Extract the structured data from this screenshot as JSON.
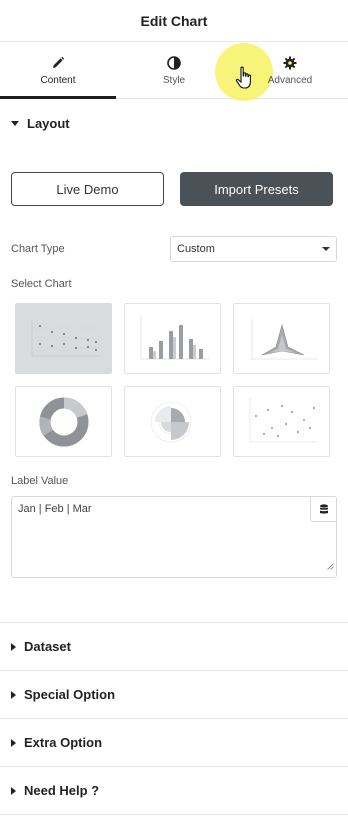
{
  "header": {
    "title": "Edit Chart"
  },
  "tabs": [
    {
      "label": "Content",
      "icon": "pencil-icon",
      "active": true
    },
    {
      "label": "Style",
      "icon": "contrast-icon",
      "active": false
    },
    {
      "label": "Advanced",
      "icon": "gear-icon",
      "active": false
    }
  ],
  "layout": {
    "title": "Layout",
    "live_demo_label": "Live Demo",
    "import_presets_label": "Import Presets",
    "chart_type_label": "Chart Type",
    "chart_type_value": "Custom",
    "select_chart_label": "Select Chart",
    "chart_options": [
      {
        "icon": "line-chart-icon",
        "selected": true
      },
      {
        "icon": "bar-chart-icon",
        "selected": false
      },
      {
        "icon": "radar-chart-icon",
        "selected": false
      },
      {
        "icon": "doughnut-chart-icon",
        "selected": false
      },
      {
        "icon": "polar-area-chart-icon",
        "selected": false
      },
      {
        "icon": "scatter-chart-icon",
        "selected": false
      }
    ],
    "label_value_label": "Label Value",
    "label_value_text": "Jan | Feb | Mar"
  },
  "sections": [
    {
      "title": "Dataset"
    },
    {
      "title": "Special Option"
    },
    {
      "title": "Extra Option"
    },
    {
      "title": "Need Help ?"
    }
  ],
  "colors": {
    "dark_button": "#4a5157",
    "selected_thumb": "#d9dcdf",
    "cursor_highlight": "#f7f162"
  }
}
